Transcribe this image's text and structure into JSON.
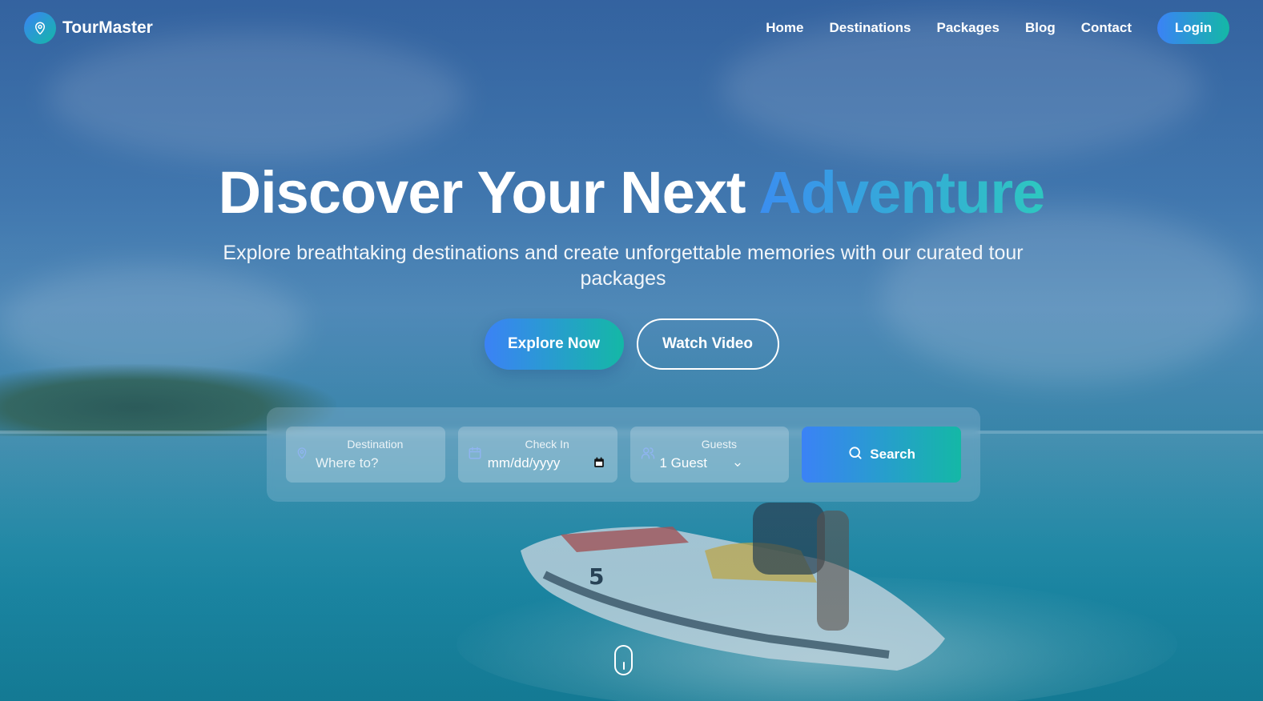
{
  "brand": {
    "name": "TourMaster",
    "logo_icon": "map-pin-icon"
  },
  "nav": {
    "items": [
      "Home",
      "Destinations",
      "Packages",
      "Blog",
      "Contact"
    ],
    "login_label": "Login"
  },
  "hero": {
    "title_main": "Discover Your Next ",
    "title_accent": "Adventure",
    "subtitle": "Explore breathtaking destinations and create unforgettable memories with our curated tour packages",
    "explore_label": "Explore Now",
    "video_label": "Watch Video"
  },
  "search": {
    "destination": {
      "label": "Destination",
      "placeholder": "Where to?",
      "icon": "map-pin-icon"
    },
    "checkin": {
      "label": "Check In",
      "value": "mm/dd/yyyy",
      "icon": "calendar-icon"
    },
    "guests": {
      "label": "Guests",
      "value": "1 Guest",
      "icon": "users-icon"
    },
    "button_label": "Search",
    "button_icon": "search-icon"
  },
  "colors": {
    "gradient_start": "#3b82f6",
    "gradient_end": "#14b8a6"
  }
}
